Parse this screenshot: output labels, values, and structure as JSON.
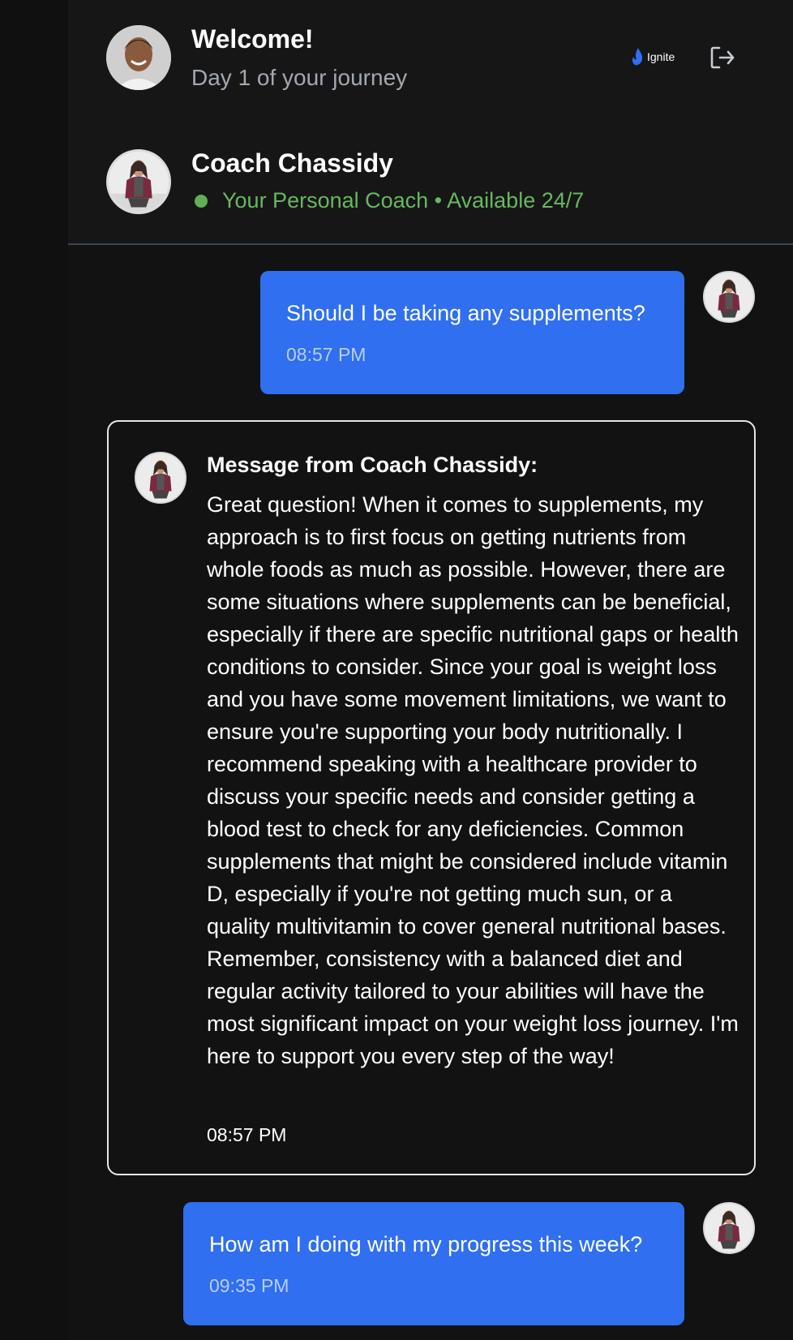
{
  "header": {
    "welcome_title": "Welcome!",
    "welcome_subtitle": "Day 1 of your journey",
    "brand_label": "Ignite",
    "brand_color": "#2f6ff0",
    "logout_icon": "logout-icon",
    "coach_name": "Coach Chassidy",
    "coach_status": "Your Personal Coach • Available 24/7",
    "status_color": "#5fb052"
  },
  "messages": [
    {
      "role": "user",
      "text": "Should I be taking any supplements?",
      "time": "08:57 PM"
    },
    {
      "role": "coach",
      "title": "Message from Coach Chassidy:",
      "text": "Great question! When it comes to supplements, my approach is to first focus on getting nutrients from whole foods as much as possible. However, there are some situations where supplements can be beneficial, especially if there are specific nutritional gaps or health conditions to consider. Since your goal is weight loss and you have some movement limitations, we want to ensure you're supporting your body nutritionally. I recommend speaking with a healthcare provider to discuss your specific needs and consider getting a blood test to check for any deficiencies. Common supplements that might be considered include vitamin D, especially if you're not getting much sun, or a quality multivitamin to cover general nutritional bases. Remember, consistency with a balanced diet and regular activity tailored to your abilities will have the most significant impact on your weight loss journey. I'm here to support you every step of the way!",
      "time": "08:57 PM"
    },
    {
      "role": "user",
      "text": "How am I doing with my progress this week?",
      "time": "09:35 PM"
    }
  ],
  "colors": {
    "user_bubble": "#2f6ff0",
    "background": "#121212"
  }
}
